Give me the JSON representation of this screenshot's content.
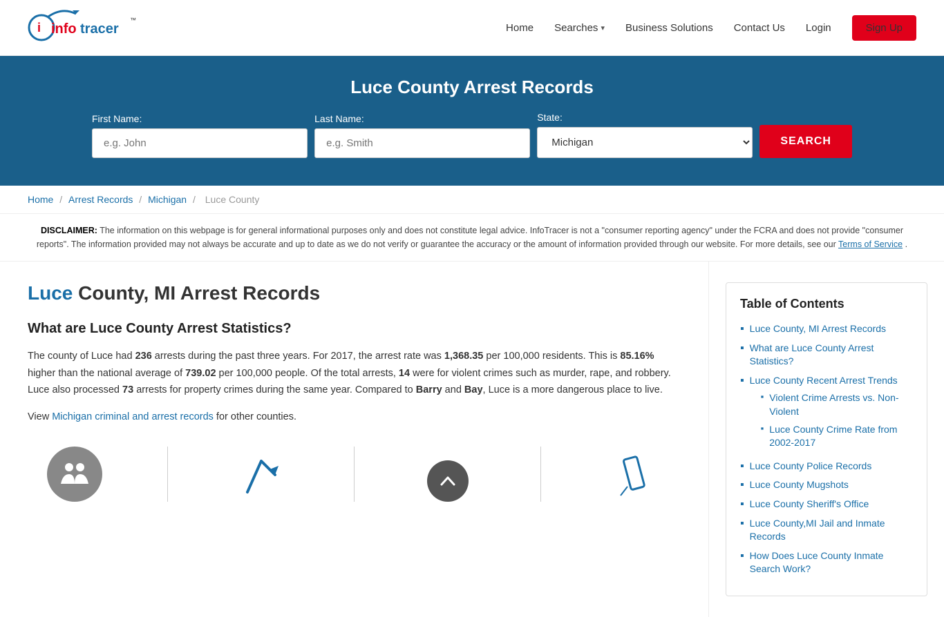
{
  "header": {
    "logo_text_red": "info",
    "logo_text_blue": "tracer",
    "logo_tm": "™",
    "nav": {
      "home": "Home",
      "searches": "Searches",
      "business_solutions": "Business Solutions",
      "contact_us": "Contact Us",
      "login": "Login",
      "signup": "Sign Up"
    }
  },
  "hero": {
    "title": "Luce County Arrest Records",
    "form": {
      "first_name_label": "First Name:",
      "first_name_placeholder": "e.g. John",
      "last_name_label": "Last Name:",
      "last_name_placeholder": "e.g. Smith",
      "state_label": "State:",
      "state_value": "Michigan",
      "search_button": "SEARCH"
    }
  },
  "breadcrumb": {
    "home": "Home",
    "arrest_records": "Arrest Records",
    "michigan": "Michigan",
    "luce_county": "Luce County"
  },
  "disclaimer": {
    "label": "DISCLAIMER:",
    "text": "The information on this webpage is for general informational purposes only and does not constitute legal advice. InfoTracer is not a \"consumer reporting agency\" under the FCRA and does not provide \"consumer reports\". The information provided may not always be accurate and up to date as we do not verify or guarantee the accuracy or the amount of information provided through our website. For more details, see our",
    "link_text": "Terms of Service",
    "period": "."
  },
  "article": {
    "title_highlight": "Luce",
    "title_rest": " County, MI Arrest Records",
    "section1_heading": "What are Luce County Arrest Statistics?",
    "paragraph1": "The county of Luce had 236 arrests during the past three years. For 2017, the arrest rate was 1,368.35 per 100,000 residents. This is 85.16% higher than the national average of 739.02 per 100,000 people. Of the total arrests, 14 were for violent crimes such as murder, rape, and robbery. Luce also processed 73 arrests for property crimes during the same year. Compared to Barry and Bay, Luce is a more dangerous place to live.",
    "paragraph2_prefix": "View ",
    "paragraph2_link": "Michigan criminal and arrest records",
    "paragraph2_suffix": " for other counties.",
    "stats": {
      "arrests": "236",
      "rate": "1,368.35",
      "higher_pct": "85.16%",
      "national_avg": "739.02",
      "violent_crimes": "14",
      "property_crimes": "73",
      "compare1": "Barry",
      "compare2": "Bay"
    }
  },
  "toc": {
    "heading": "Table of Contents",
    "items": [
      {
        "label": "Luce County, MI Arrest Records",
        "href": "#"
      },
      {
        "label": "What are Luce County Arrest Statistics?",
        "href": "#"
      },
      {
        "label": "Luce County Recent Arrest Trends",
        "href": "#",
        "subitems": [
          {
            "label": "Violent Crime Arrests vs. Non-Violent",
            "href": "#"
          },
          {
            "label": "Luce County Crime Rate from 2002-2017",
            "href": "#"
          }
        ]
      },
      {
        "label": "Luce County Police Records",
        "href": "#"
      },
      {
        "label": "Luce County Mugshots",
        "href": "#"
      },
      {
        "label": "Luce County Sheriff's Office",
        "href": "#"
      },
      {
        "label": "Luce County,MI Jail and Inmate Records",
        "href": "#"
      },
      {
        "label": "How Does Luce County Inmate Search Work?",
        "href": "#"
      }
    ]
  }
}
